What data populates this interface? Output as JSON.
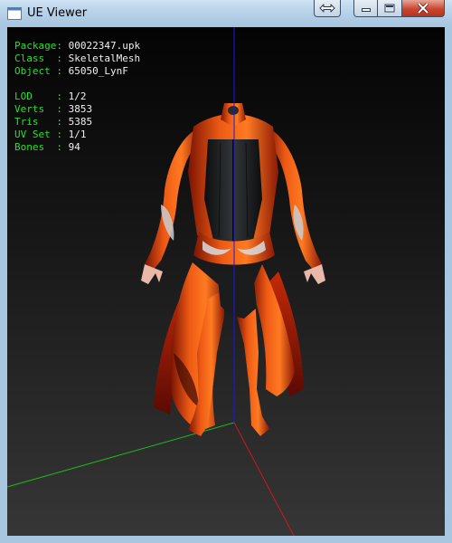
{
  "window": {
    "title": "UE Viewer"
  },
  "info": {
    "package": {
      "label": "Package",
      "sep": ": ",
      "value": "00022347.upk"
    },
    "class": {
      "label": "Class  ",
      "sep": ": ",
      "value": "SkeletalMesh"
    },
    "object": {
      "label": "Object ",
      "sep": ": ",
      "value": "65050_LynF"
    },
    "lod": {
      "label": "LOD    ",
      "sep": ": ",
      "value": "1/2"
    },
    "verts": {
      "label": "Verts  ",
      "sep": ": ",
      "value": "3853"
    },
    "tris": {
      "label": "Tris   ",
      "sep": ": ",
      "value": "5385"
    },
    "uvset": {
      "label": "UV Set ",
      "sep": ": ",
      "value": "1/1"
    },
    "bones": {
      "label": "Bones  ",
      "sep": ": ",
      "value": "94"
    }
  },
  "colors": {
    "label_green": "#28e028",
    "axis_x": "#d01818",
    "axis_y": "#18c018",
    "axis_z": "#1a1ae0",
    "armor_orange": "#e0400c",
    "armor_black": "#1a1c1e"
  },
  "icons": [
    "app-icon",
    "swap-icon",
    "minimize-icon",
    "maximize-icon",
    "close-icon"
  ]
}
